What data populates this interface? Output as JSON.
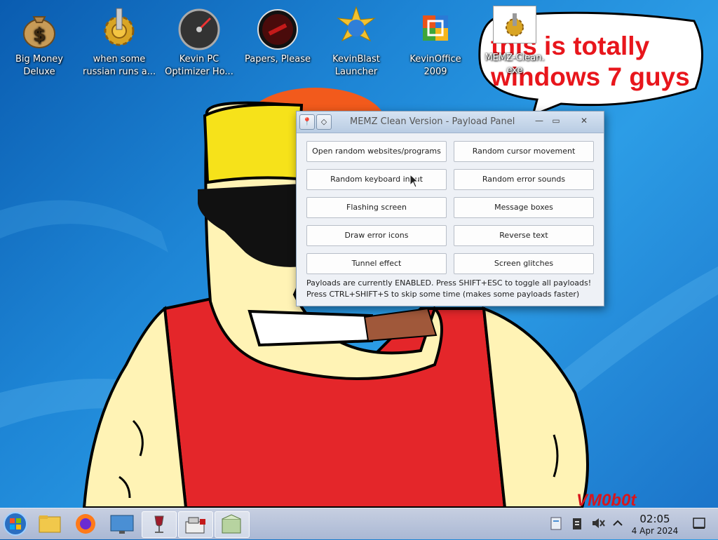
{
  "desktop": {
    "icons": [
      {
        "label_line1": "Big Money",
        "label_line2": "Deluxe",
        "icon": "money-bag-icon"
      },
      {
        "label_line1": "when some",
        "label_line2": "russian runs a...",
        "icon": "gear-icon"
      },
      {
        "label_line1": "Kevin PC",
        "label_line2": "Optimizer Ho...",
        "icon": "speedometer-icon"
      },
      {
        "label_line1": "Papers, Please",
        "label_line2": "",
        "icon": "papers-please-icon"
      },
      {
        "label_line1": "KevinBlast",
        "label_line2": "Launcher",
        "icon": "kevinblast-icon"
      },
      {
        "label_line1": "KevinOffice",
        "label_line2": "2009",
        "icon": "office-icon"
      },
      {
        "label_line1": "MEMZ-Clean.",
        "label_line2": "exe",
        "icon": "memz-icon"
      }
    ],
    "speech_bubble": {
      "line1": "this is totally",
      "line2": "windows 7 guys"
    },
    "watermark": "VM0b0t"
  },
  "window": {
    "title": "MEMZ Clean Version - Payload Panel",
    "buttons": [
      "Open random websites/programs",
      "Random cursor movement",
      "Random keyboard input",
      "Random error sounds",
      "Flashing screen",
      "Message boxes",
      "Draw error icons",
      "Reverse text",
      "Tunnel effect",
      "Screen glitches"
    ],
    "status_line1": "Payloads are currently ENABLED. Press SHIFT+ESC to toggle all payloads!",
    "status_line2": "Press CTRL+SHIFT+S to skip some time (makes some payloads faster)"
  },
  "taskbar": {
    "items": [
      "start-orb-icon",
      "file-manager-icon",
      "firefox-icon",
      "monitor-icon",
      "wine-glass-icon",
      "cash-register-icon",
      "package-icon"
    ],
    "tray": [
      "clipboard-notes-icon",
      "clipboard-icon",
      "speaker-muted-icon",
      "chevron-up-icon",
      "show-desktop-icon"
    ],
    "time": "02:05",
    "date": "4 Apr 2024"
  },
  "colors": {
    "bubble_text": "#e8161c",
    "desktop_blue": "#1e86d6",
    "shirt_red": "#e4262a",
    "skin": "#fff3b5",
    "hair": "#f6e21a"
  }
}
